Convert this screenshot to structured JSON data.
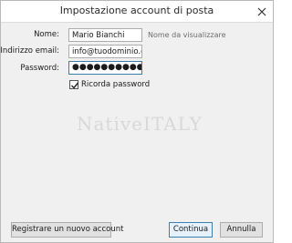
{
  "window": {
    "title": "Impostazione account di posta",
    "close_icon": "close-icon"
  },
  "form": {
    "name_label": "Nome:",
    "name_value": "Mario Bianchi",
    "name_hint": "Nome da visualizzare",
    "email_label": "Indirizzo email:",
    "email_value": "info@tuodominio.eu",
    "password_label": "Password:",
    "password_value": "●●●●●●●●●●●",
    "remember_label": "Ricorda password",
    "remember_checked": true
  },
  "watermark": {
    "text_part1": "Native",
    "text_part2": "ITALY"
  },
  "buttons": {
    "register": "Registrare un nuovo account",
    "continue": "Continua",
    "cancel": "Annulla"
  },
  "colors": {
    "accent": "#3c7fb1",
    "background": "#f0f0f0"
  }
}
